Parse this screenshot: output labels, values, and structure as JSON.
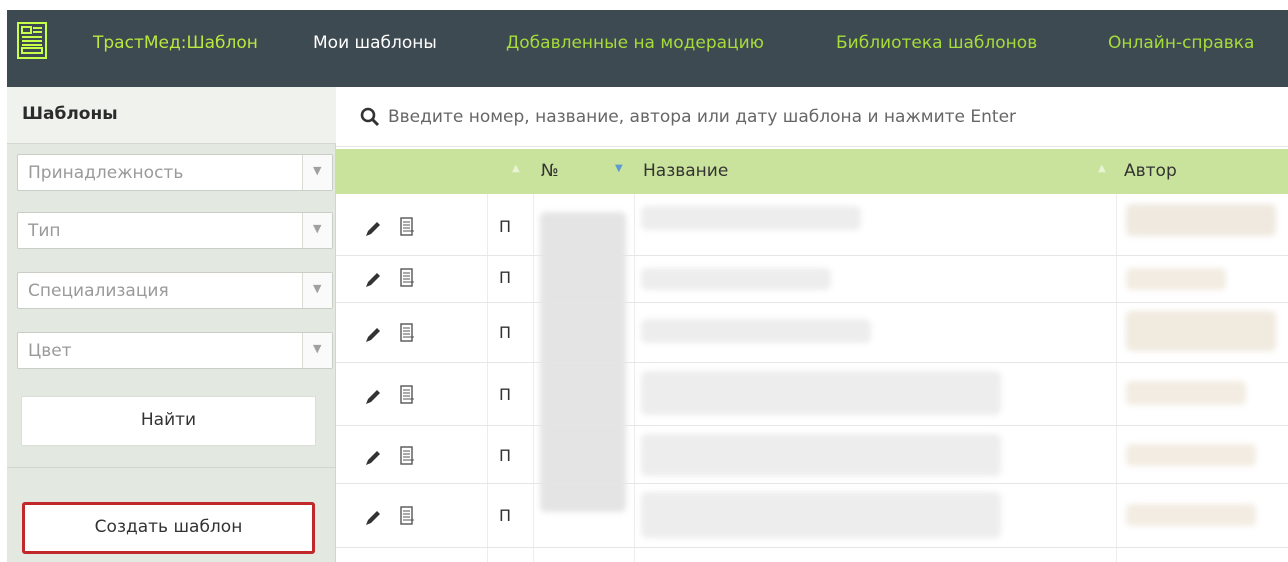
{
  "nav": {
    "brand": "ТрастМед:Шаблон",
    "items": [
      {
        "label": "Мои шаблоны",
        "active": true
      },
      {
        "label": "Добавленные на модерацию",
        "active": false
      },
      {
        "label": "Библиотека шаблонов",
        "active": false
      },
      {
        "label": "Онлайн-справка",
        "active": false
      }
    ]
  },
  "sidebar": {
    "title": "Шаблоны",
    "filters": [
      {
        "placeholder": "Принадлежность"
      },
      {
        "placeholder": "Тип"
      },
      {
        "placeholder": "Специализация"
      },
      {
        "placeholder": "Цвет"
      }
    ],
    "find_label": "Найти",
    "create_label": "Создать шаблон"
  },
  "search": {
    "placeholder": "Введите номер, название, автора или дату шаблона и нажмите Enter"
  },
  "table": {
    "columns": [
      "№",
      "Название",
      "Автор"
    ],
    "rows": [
      {
        "type": "П"
      },
      {
        "type": "П"
      },
      {
        "type": "П"
      },
      {
        "type": "П"
      },
      {
        "type": "П"
      },
      {
        "type": "П"
      }
    ]
  },
  "colors": {
    "nav_bg": "#3e4a51",
    "nav_link": "#a6dc3a",
    "table_header": "#c9e39c",
    "create_border": "#c0282a"
  },
  "icons": {
    "logo": "template-logo-icon",
    "search": "search-icon",
    "edit": "pencil-icon",
    "view": "document-icon",
    "sort": "sort-arrow-icon"
  }
}
